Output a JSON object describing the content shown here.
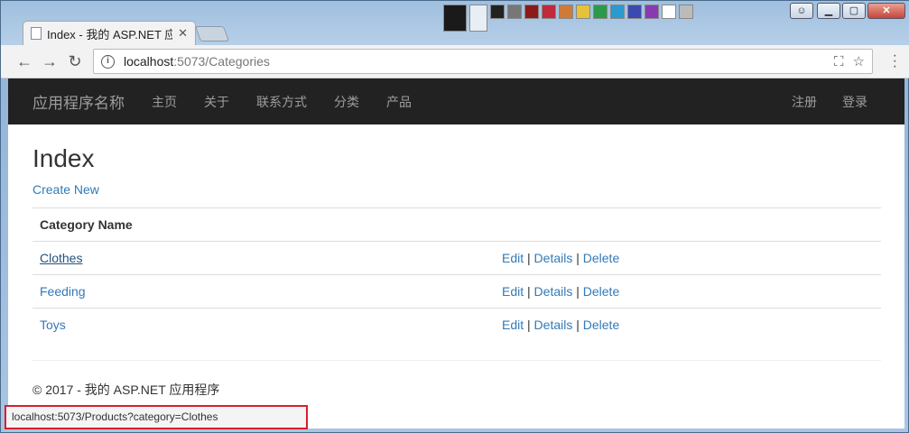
{
  "browser": {
    "tab_title": "Index - 我的 ASP.NET 应用程序",
    "url_host": "localhost",
    "url_path": ":5073/Categories",
    "status_url": "localhost:5073/Products?category=Clothes"
  },
  "nav": {
    "brand": "应用程序名称",
    "links": [
      "主页",
      "关于",
      "联系方式",
      "分类",
      "产品"
    ],
    "right": [
      "注册",
      "登录"
    ]
  },
  "page": {
    "heading": "Index",
    "create_new": "Create New",
    "column_header": "Category Name",
    "rows": [
      {
        "name": "Clothes",
        "edit": "Edit",
        "details": "Details",
        "delete": "Delete"
      },
      {
        "name": "Feeding",
        "edit": "Edit",
        "details": "Details",
        "delete": "Delete"
      },
      {
        "name": "Toys",
        "edit": "Edit",
        "details": "Details",
        "delete": "Delete"
      }
    ],
    "separator": "|",
    "footer": "© 2017 - 我的 ASP.NET 应用程序"
  },
  "colors": {
    "link": "#337ab7",
    "navbar_bg": "#222222",
    "status_highlight": "#d81e2c"
  }
}
